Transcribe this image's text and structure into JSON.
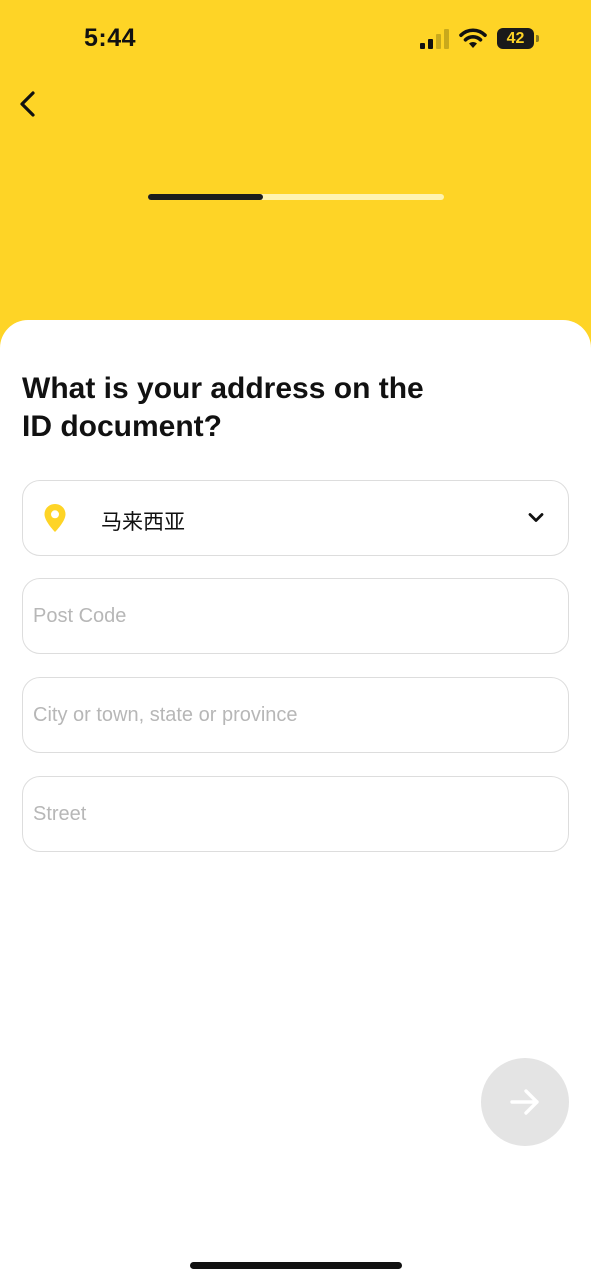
{
  "status_bar": {
    "time": "5:44",
    "battery_level": "42",
    "signal_icon": "cellular-signal-icon",
    "wifi_icon": "wifi-icon",
    "battery_icon": "battery-icon"
  },
  "header": {
    "back_icon": "chevron-left-icon",
    "progress_fraction": 0.39
  },
  "form": {
    "title": "What is your address on the ID document?",
    "country": {
      "icon": "location-pin-icon",
      "value": "马来西亚",
      "dropdown_icon": "chevron-down-icon"
    },
    "post_code": {
      "value": "",
      "placeholder": "Post Code"
    },
    "city": {
      "value": "",
      "placeholder": "City or town, state or province"
    },
    "street": {
      "value": "",
      "placeholder": "Street"
    },
    "next_icon": "arrow-right-icon"
  },
  "colors": {
    "brand_yellow": "#fed426",
    "progress_fill": "#1c1c1c",
    "progress_track": "#fff3b0",
    "pin": "#fed426",
    "next_button_disabled": "#e4e4e4"
  }
}
